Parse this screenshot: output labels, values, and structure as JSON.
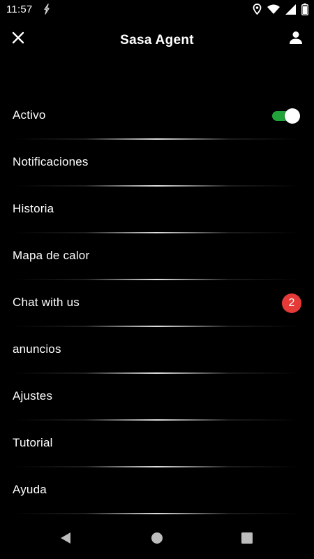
{
  "status_bar": {
    "time": "11:57",
    "left_icon": "bolt-icon",
    "right_icons": [
      "location-icon",
      "wifi-icon",
      "signal-icon",
      "battery-icon"
    ]
  },
  "header": {
    "title": "Sasa Agent",
    "close_icon": "close-icon",
    "profile_icon": "person-icon"
  },
  "menu": {
    "items": [
      {
        "label": "Activo",
        "toggle_on": true
      },
      {
        "label": "Notificaciones"
      },
      {
        "label": "Historia"
      },
      {
        "label": "Mapa de calor"
      },
      {
        "label": "Chat with us",
        "badge": "2"
      },
      {
        "label": "anuncios"
      },
      {
        "label": "Ajustes"
      },
      {
        "label": "Tutorial"
      },
      {
        "label": "Ayuda"
      }
    ]
  },
  "nav_bar": {
    "icons": [
      "back-icon",
      "home-icon",
      "recents-icon"
    ]
  },
  "colors": {
    "background": "#000000",
    "toggle_on": "#21a33a",
    "badge": "#e53a37"
  }
}
